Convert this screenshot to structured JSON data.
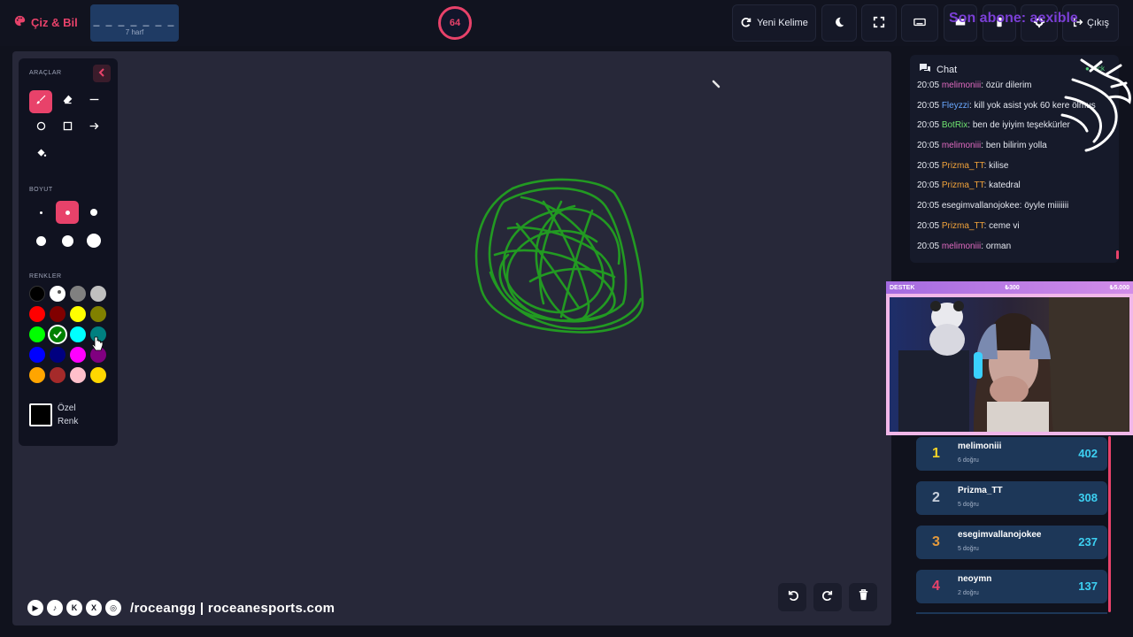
{
  "brand": {
    "name": "Çiz & Bil"
  },
  "word": {
    "mask": "_ _ _ _ _ _ _",
    "hint": "7 harf"
  },
  "timer": {
    "seconds": "64"
  },
  "toolbar": {
    "new_word_label": "Yeni Kelime"
  },
  "overlay": {
    "subscriber_text": "Son abone: aexible",
    "exit_label": "Çıkış"
  },
  "tools": {
    "section_tools": "ARAÇLAR",
    "section_size": "BOYUT",
    "section_colors": "RENKLER",
    "custom_color_label": "Özel Renk",
    "selected_color": "#2e8b1f",
    "selected_tool": "brush",
    "selected_size_index": 1,
    "colors": [
      "#000000",
      "#ffffff",
      "#808080",
      "#c0c0c0",
      "#ff0000",
      "#800000",
      "#ffff00",
      "#808000",
      "#00ff00",
      "#008000",
      "#00ffff",
      "#008080",
      "#0000ff",
      "#000080",
      "#ff00ff",
      "#800080",
      "#ffa500",
      "#a52a2a",
      "#ffc0cb",
      "#ffd700"
    ]
  },
  "chat": {
    "title": "Chat",
    "platform": "Kick",
    "messages": [
      {
        "time": "20:05",
        "user": "melimoniii",
        "color": "#e06ac0",
        "text": "özür dilerim"
      },
      {
        "time": "20:05",
        "user": "Fleyzzi",
        "color": "#6aa8ff",
        "text": "kill yok asist yok 60 kere ölmuş"
      },
      {
        "time": "20:05",
        "user": "BotRix",
        "color": "#6fe36f",
        "text": "ben de iyiyim teşekkürler"
      },
      {
        "time": "20:05",
        "user": "melimoniii",
        "color": "#e06ac0",
        "text": "ben bilirim yolla"
      },
      {
        "time": "20:05",
        "user": "Prizma_TT",
        "color": "#f2a33a",
        "text": "kilise"
      },
      {
        "time": "20:05",
        "user": "Prizma_TT",
        "color": "#f2a33a",
        "text": "katedral"
      },
      {
        "time": "20:05",
        "user": "esegimvallanojokee",
        "color": "#e5e8f0",
        "text": "öyyle miiiiiii"
      },
      {
        "time": "20:05",
        "user": "Prizma_TT",
        "color": "#f2a33a",
        "text": "ceme vi"
      },
      {
        "time": "20:05",
        "user": "melimoniii",
        "color": "#e06ac0",
        "text": "orman"
      }
    ]
  },
  "support": {
    "label": "DESTEK",
    "current": "₺300",
    "goal": "₺5.000"
  },
  "leaderboard": [
    {
      "rank": "1",
      "name": "melimoniii",
      "sub": "6 doğru",
      "score": "402",
      "rank_color": "#f5d327"
    },
    {
      "rank": "2",
      "name": "Prizma_TT",
      "sub": "5 doğru",
      "score": "308",
      "rank_color": "#c8d0dc"
    },
    {
      "rank": "3",
      "name": "esegimvallanojokee",
      "sub": "5 doğru",
      "score": "237",
      "rank_color": "#e49a3c"
    },
    {
      "rank": "4",
      "name": "neoymn",
      "sub": "2 doğru",
      "score": "137",
      "rank_color": "#e8426a"
    }
  ],
  "social": {
    "handle_text": "/roceangg | roceanesports.com"
  },
  "colors": {
    "accent": "#e8426a",
    "canvas_bg": "#272839",
    "panel_bg": "#101220"
  }
}
